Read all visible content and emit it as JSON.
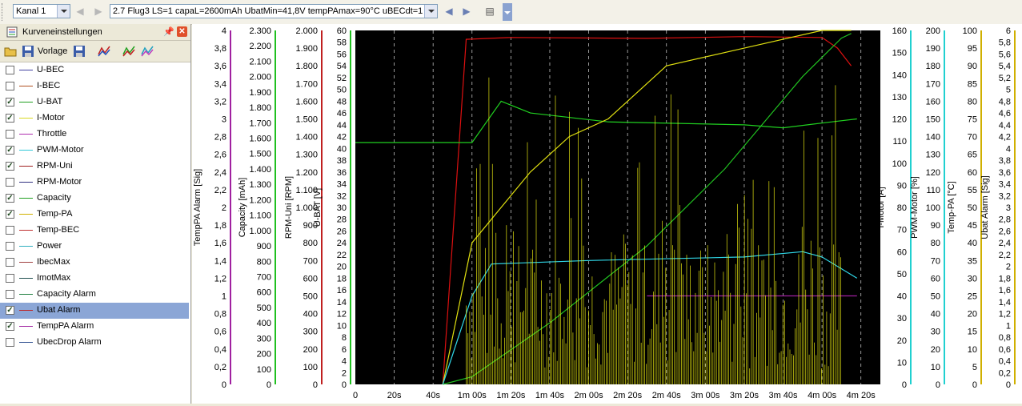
{
  "toolbar": {
    "channel": "Kanal 1",
    "flight": "2.7 Flug3 LS=1 capaL=2600mAh UbatMin=41,8V tempPAmax=90°C uBECdt=1"
  },
  "panel": {
    "title": "Kurveneinstellungen",
    "template_label": "Vorlage",
    "items": [
      {
        "label": "U-BEC",
        "checked": false,
        "color": "#4040a0"
      },
      {
        "label": "I-BEC",
        "checked": false,
        "color": "#b05020"
      },
      {
        "label": "U-BAT",
        "checked": true,
        "color": "#20a020"
      },
      {
        "label": "I-Motor",
        "checked": true,
        "color": "#d8d820"
      },
      {
        "label": "Throttle",
        "checked": false,
        "color": "#b030b0"
      },
      {
        "label": "PWM-Motor",
        "checked": true,
        "color": "#30c8d8"
      },
      {
        "label": "RPM-Uni",
        "checked": true,
        "color": "#a02020"
      },
      {
        "label": "RPM-Motor",
        "checked": false,
        "color": "#303080"
      },
      {
        "label": "Capacity",
        "checked": true,
        "color": "#20a020"
      },
      {
        "label": "Temp-PA",
        "checked": true,
        "color": "#d0b000"
      },
      {
        "label": "Temp-BEC",
        "checked": false,
        "color": "#c03030"
      },
      {
        "label": "Power",
        "checked": false,
        "color": "#30b0c0"
      },
      {
        "label": "IbecMax",
        "checked": false,
        "color": "#a04040"
      },
      {
        "label": "ImotMax",
        "checked": false,
        "color": "#205050"
      },
      {
        "label": "Capacity Alarm",
        "checked": false,
        "color": "#208040"
      },
      {
        "label": "Ubat Alarm",
        "checked": true,
        "color": "#c02020",
        "selected": true
      },
      {
        "label": "TempPA Alarm",
        "checked": true,
        "color": "#a020a0"
      },
      {
        "label": "UbecDrop Alarm",
        "checked": false,
        "color": "#305090"
      }
    ]
  },
  "chart_data": {
    "type": "line",
    "x_axis": {
      "ticks": [
        "0",
        "20s",
        "40s",
        "1m 00s",
        "1m 20s",
        "1m 40s",
        "2m 00s",
        "2m 20s",
        "2m 40s",
        "3m 00s",
        "3m 20s",
        "3m 40s",
        "4m 00s",
        "4m 20s"
      ],
      "range_s": [
        0,
        270
      ]
    },
    "axes": [
      {
        "name": "TempPA Alarm [Sig]",
        "side": "left",
        "color": "#a020a0",
        "ticks": [
          "0",
          "0,2",
          "0,4",
          "0,6",
          "0,8",
          "1",
          "1,2",
          "1,4",
          "1,6",
          "1,8",
          "2",
          "2,2",
          "2,4",
          "2,6",
          "2,8",
          "3",
          "3,2",
          "3,4",
          "3,6",
          "3,8",
          "4"
        ]
      },
      {
        "name": "Capacity [mAh]",
        "side": "left",
        "color": "#20c020",
        "ticks": [
          "0",
          "100",
          "200",
          "300",
          "400",
          "500",
          "600",
          "700",
          "800",
          "900",
          "1.000",
          "1.100",
          "1.200",
          "1.300",
          "1.400",
          "1.500",
          "1.600",
          "1.700",
          "1.800",
          "1.900",
          "2.000",
          "2.100",
          "2.200",
          "2.300"
        ]
      },
      {
        "name": "RPM-Uni [RPM]",
        "side": "left",
        "color": "#c02020",
        "ticks": [
          "0",
          "100",
          "200",
          "300",
          "400",
          "500",
          "600",
          "700",
          "800",
          "900",
          "1.000",
          "1.100",
          "1.200",
          "1.300",
          "1.400",
          "1.500",
          "1.600",
          "1.700",
          "1.800",
          "1.900",
          "2.000"
        ]
      },
      {
        "name": "U-BAT [V]",
        "side": "left",
        "color": "#20c020",
        "ticks": [
          "0",
          "2",
          "4",
          "6",
          "8",
          "10",
          "12",
          "14",
          "16",
          "18",
          "20",
          "22",
          "24",
          "26",
          "28",
          "30",
          "32",
          "34",
          "36",
          "38",
          "40",
          "42",
          "44",
          "46",
          "48",
          "50",
          "52",
          "54",
          "56",
          "58",
          "60"
        ]
      },
      {
        "name": "I-Motor [A]",
        "side": "right",
        "color": "#20d0d0",
        "ticks": [
          "0",
          "10",
          "20",
          "30",
          "40",
          "50",
          "60",
          "70",
          "80",
          "90",
          "100",
          "110",
          "120",
          "130",
          "140",
          "150",
          "160"
        ]
      },
      {
        "name": "PWM-Motor [%]",
        "side": "right",
        "color": "#20d0d0",
        "ticks": [
          "0",
          "10",
          "20",
          "30",
          "40",
          "50",
          "60",
          "70",
          "80",
          "90",
          "100",
          "110",
          "120",
          "130",
          "140",
          "150",
          "160",
          "170",
          "180",
          "190",
          "200"
        ]
      },
      {
        "name": "Temp-PA [°C]",
        "side": "right",
        "color": "#d0b000",
        "ticks": [
          "0",
          "5",
          "10",
          "15",
          "20",
          "25",
          "30",
          "35",
          "40",
          "45",
          "50",
          "55",
          "60",
          "65",
          "70",
          "75",
          "80",
          "85",
          "90",
          "95",
          "100"
        ]
      },
      {
        "name": "Ubat Alarm [Sig]",
        "side": "right",
        "color": "#d0b000",
        "ticks": [
          "0",
          "0,2",
          "0,4",
          "0,6",
          "0,8",
          "1",
          "1,2",
          "1,4",
          "1,6",
          "1,8",
          "2",
          "2,2",
          "2,4",
          "2,6",
          "2,8",
          "3",
          "3,2",
          "3,4",
          "3,6",
          "3,8",
          "4",
          "4,2",
          "4,4",
          "4,6",
          "4,8",
          "5",
          "5,2",
          "5,4",
          "5,6",
          "5,8",
          "6"
        ]
      }
    ],
    "series": [
      {
        "color": "#dd1010",
        "points": [
          [
            45,
            0
          ],
          [
            57,
            1950
          ],
          [
            80,
            1960
          ],
          [
            150,
            1955
          ],
          [
            200,
            1965
          ],
          [
            240,
            1960
          ],
          [
            248,
            1900
          ],
          [
            255,
            1800
          ]
        ]
      },
      {
        "color": "#20d020",
        "points": [
          [
            0,
            41
          ],
          [
            60,
            41
          ],
          [
            75,
            48
          ],
          [
            90,
            46
          ],
          [
            130,
            44.5
          ],
          [
            200,
            44
          ],
          [
            220,
            43.5
          ],
          [
            245,
            44.5
          ],
          [
            258,
            45
          ]
        ]
      },
      {
        "color": "#20c020",
        "points": [
          [
            45,
            0
          ],
          [
            60,
            50
          ],
          [
            100,
            400
          ],
          [
            150,
            900
          ],
          [
            190,
            1400
          ],
          [
            230,
            2000
          ],
          [
            250,
            2250
          ],
          [
            255,
            2280
          ]
        ]
      },
      {
        "color": "#e0e010",
        "points": [
          [
            45,
            0
          ],
          [
            60,
            40
          ],
          [
            75,
            50
          ],
          [
            90,
            60
          ],
          [
            110,
            70
          ],
          [
            130,
            75
          ],
          [
            160,
            90
          ],
          [
            200,
            95
          ],
          [
            240,
            100
          ],
          [
            255,
            100
          ]
        ]
      },
      {
        "color": "#30d8e8",
        "points": [
          [
            45,
            0
          ],
          [
            60,
            50
          ],
          [
            70,
            68
          ],
          [
            120,
            70
          ],
          [
            200,
            72
          ],
          [
            230,
            75
          ],
          [
            240,
            72
          ],
          [
            258,
            60
          ]
        ]
      },
      {
        "color": "#a020a0",
        "points": [
          [
            150,
            1
          ],
          [
            258,
            1
          ]
        ]
      }
    ]
  }
}
